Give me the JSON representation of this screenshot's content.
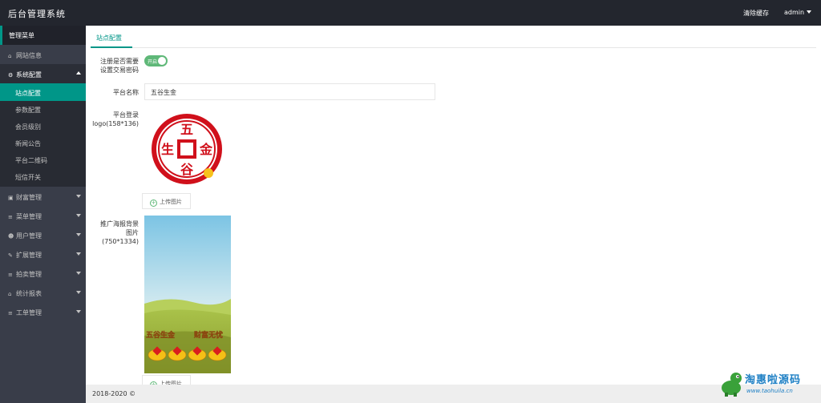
{
  "header": {
    "brand": "后台管理系统",
    "clear_cache": "清除缓存",
    "user": "admin"
  },
  "sidebar": {
    "title": "管理菜单",
    "items": [
      {
        "label": "网站信息",
        "icon": "home-icon"
      },
      {
        "label": "系统配置",
        "icon": "gears-icon",
        "expanded": true,
        "children": [
          "站点配置",
          "参数配置",
          "会员级别",
          "新闻公告",
          "平台二维码",
          "短信开关"
        ],
        "active_child": "站点配置"
      },
      {
        "label": "财富管理",
        "icon": "wealth-icon"
      },
      {
        "label": "菜单管理",
        "icon": "menu-icon"
      },
      {
        "label": "用户管理",
        "icon": "users-icon"
      },
      {
        "label": "扩展管理",
        "icon": "wrench-icon"
      },
      {
        "label": "拍卖管理",
        "icon": "list-icon"
      },
      {
        "label": "统计报表",
        "icon": "chart-icon"
      },
      {
        "label": "工单管理",
        "icon": "list-icon"
      }
    ]
  },
  "tab": {
    "label": "站点配置"
  },
  "form": {
    "trade_pwd_label_1": "注册是否需要",
    "trade_pwd_label_2": "设置交易密码",
    "trade_pwd_toggle": "开启",
    "platform_name_label": "平台名称",
    "platform_name_value": "五谷生金",
    "logo_label_1": "平台登录",
    "logo_label_2": "logo(158*136)",
    "logo_chars": {
      "top": "五",
      "left": "生",
      "right": "金",
      "bottom": "谷"
    },
    "upload_label": "上传图片",
    "poster_label_1": "推广海报背景",
    "poster_label_2": "图片",
    "poster_label_3": "(750*1334)",
    "poster_text_1": "五谷生金",
    "poster_text_2": "财富无忧"
  },
  "footer": {
    "text": "2018-2020 ©"
  },
  "watermark": {
    "title": "淘惠啦源码",
    "subtitle": "www.taohuila.cn"
  },
  "colors": {
    "accent": "#009688",
    "toggle": "#5fb878",
    "header": "#23262e",
    "sidebar": "#393d49",
    "logo_red": "#d0101b"
  }
}
